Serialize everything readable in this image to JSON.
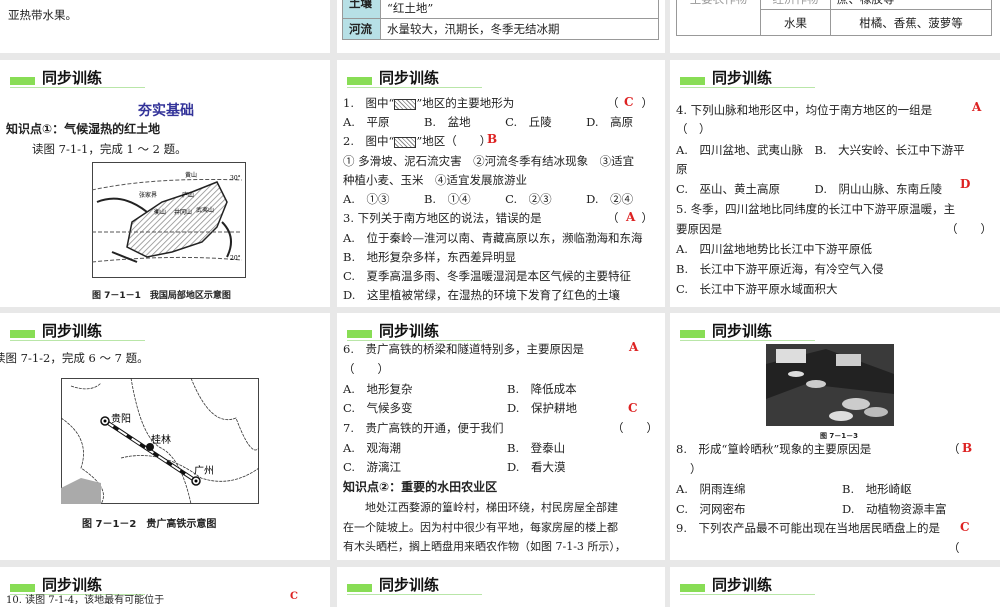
{
  "row0": {
    "left_text": "亚热带水果。",
    "mid_table": [
      [
        "土壤",
        "“红土地”"
      ],
      [
        "河流",
        "水量较大，汛期长，冬季无结冰期"
      ]
    ],
    "right_table": [
      [
        "主要农作物",
        "经济作物",
        "蔗、橡胶等"
      ],
      [
        "",
        "水果",
        "柑橘、香蕉、菠萝等"
      ]
    ]
  },
  "header_title": "同步训练",
  "p1": {
    "section": "夯实基础",
    "kp": "知识点①：气候湿热的红土地",
    "intro": "读图 7-1-1，完成 1 ～ 2 题。",
    "map_labels": [
      "黄山",
      "张家界",
      "庐山",
      "衡山",
      "井冈山",
      "武夷山",
      "30°",
      "20°"
    ],
    "caption": "图 7－1－1　我国局部地区示意图"
  },
  "p2": {
    "lines": [
      "1.　图中“",
      "”地区的主要地形为",
      "A.　平原　　　B.　盆地　　　C.　丘陵　　　D.　高原",
      "2.　图中“",
      "”地区（　　）",
      "① 多滑坡、泥石流灾害　②河流冬季有结冰现象　③适宜",
      "种植小麦、玉米　④适宜发展旅游业",
      "A.　①③　　　B.　①④　　　C.　②③　　　D.　②④",
      "3. 下列关于南方地区的说法，错误的是",
      "A.　位于秦岭—淮河以南、青藏高原以东，濒临渤海和东海",
      "B.　地形复杂多样，东西差异明显",
      "C.　夏季高温多雨、冬季温暖湿润是本区气候的主要特征",
      "D.　这里植被常绿，在湿热的环境下发育了红色的土壤"
    ],
    "paren": "（　　）",
    "answers": [
      "C",
      "B",
      "A"
    ]
  },
  "p3": {
    "lines": [
      "4. 下列山脉和地形区中，均位于南方地区的一组是",
      "（　）",
      "A.　四川盆地、武夷山脉　B.　大兴安岭、长江中下游平",
      "原",
      "C.　巫山、黄土高原　　　D.　阴山山脉、东南丘陵",
      "5. 冬季，四川盆地比同纬度的长江中下游平原温暖，主",
      "要原因是",
      "A.　四川盆地地势比长江中下游平原低",
      "B.　长江中下游平原近海，有冷空气入侵",
      "C.　长江中下游平原水域面积大"
    ],
    "paren": "（　　）",
    "answers": [
      "A",
      "D"
    ]
  },
  "p4": {
    "intro": "读图 7-1-2，完成 6 ～ 7 题。",
    "map_labels": [
      "贵阳",
      "桂林",
      "广州"
    ],
    "caption": "图 7－1－2　贵广高铁示意图"
  },
  "p5": {
    "lines": [
      "6.　贵广高铁的桥梁和隧道特别多，主要原因是",
      "（　　）",
      "A.　地形复杂",
      "B.　降低成本",
      "C.　气候多变",
      "D.　保护耕地",
      "7.　贵广高铁的开通，便于我们",
      "A.　观海潮",
      "B.　登泰山",
      "C.　游漓江",
      "D.　看大漠",
      "知识点②：重要的水田农业区",
      "　　地处江西婺源的篁岭村，梯田环绕，村民房屋全部建",
      "在一个陡坡上。因为村中很少有平地，每家房屋的楼上都",
      "有木头晒栏，搁上晒盘用来晒农作物（如图 7-1-3 所示），"
    ],
    "paren": "（　　）",
    "answers": [
      "A",
      "C"
    ]
  },
  "p6": {
    "caption": "图 7－1－3",
    "lines": [
      "8.　形成“篁岭晒秋”现象的主要原因是",
      "）",
      "A.　阴雨连绵",
      "B.　地形崎岖",
      "C.　河网密布",
      "D.　动植物资源丰富",
      "9.　下列农产品最不可能出现在当地居民晒盘上的是"
    ],
    "paren_open": "（",
    "answers": [
      "B",
      "C"
    ]
  },
  "p7": {
    "line": "10. 读图 7-1-4，该地最有可能位于",
    "answer": "C"
  }
}
